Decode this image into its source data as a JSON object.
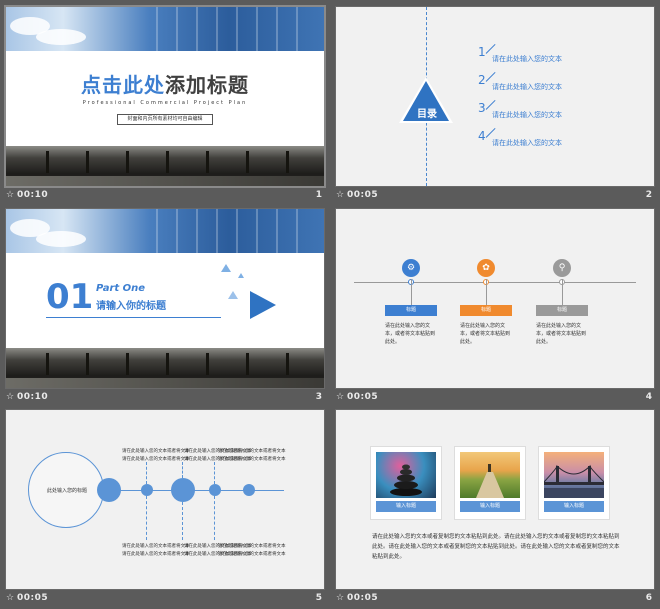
{
  "slides": [
    {
      "number": "1",
      "time": "00:10",
      "title_accent": "点击此处",
      "title_rest": "添加标题",
      "subtitle": "Professional Commercial Project Plan",
      "note": "封面和内页所有素材均可自由编辑"
    },
    {
      "number": "2",
      "time": "00:05",
      "toc_label": "目录",
      "items": [
        {
          "num": "1",
          "text": "请在此处输入您的文本"
        },
        {
          "num": "2",
          "text": "请在此处输入您的文本"
        },
        {
          "num": "3",
          "text": "请在此处输入您的文本"
        },
        {
          "num": "4",
          "text": "请在此处输入您的文本"
        }
      ]
    },
    {
      "number": "3",
      "time": "00:10",
      "big_number": "01",
      "part": "Part One",
      "title": "请输入你的标题"
    },
    {
      "number": "4",
      "time": "00:05",
      "columns": [
        {
          "label": "标题",
          "text": "请在此处输入您的文本，或者将文本粘贴到此处。",
          "color": "#3d7fd1",
          "icon": "gear-icon",
          "glyph": "⚙"
        },
        {
          "label": "标题",
          "text": "请在此处输入您的文本，或者将文本粘贴到此处。",
          "color": "#f08a2e",
          "icon": "gift-icon",
          "glyph": "✿"
        },
        {
          "label": "标题",
          "text": "请在此处输入您的文本，或者将文本粘贴到此处。",
          "color": "#9a9a9a",
          "icon": "search-icon",
          "glyph": "⚲"
        }
      ]
    },
    {
      "number": "5",
      "time": "00:05",
      "ring_label": "此处输入您的标题",
      "labels_top": [
        "请在此处输入您的文本或者将文本",
        "请在此处输入您的文本或者将文本",
        "请在此处输入您的文本或者将文本"
      ],
      "labels_bottom": [
        "请在此处输入您的文本或者将文本",
        "请在此处输入您的文本或者将文本",
        "请在此处输入您的文本或者将文本"
      ]
    },
    {
      "number": "6",
      "time": "00:05",
      "captions": [
        "输入标题",
        "输入标题",
        "输入标题"
      ],
      "paragraph": "请在此处输入您的文本或者复制您的文本粘贴到此处。请在此处输入您的文本或者复制您的文本粘贴到此处。请在此处输入您的文本或者复制您的文本粘贴到此处。请在此处输入您的文本或者复制您的文本粘贴到此处。"
    }
  ],
  "star_glyph": "☆",
  "colors": {
    "accent": "#3d7fd1",
    "background": "#5b5b5b"
  }
}
